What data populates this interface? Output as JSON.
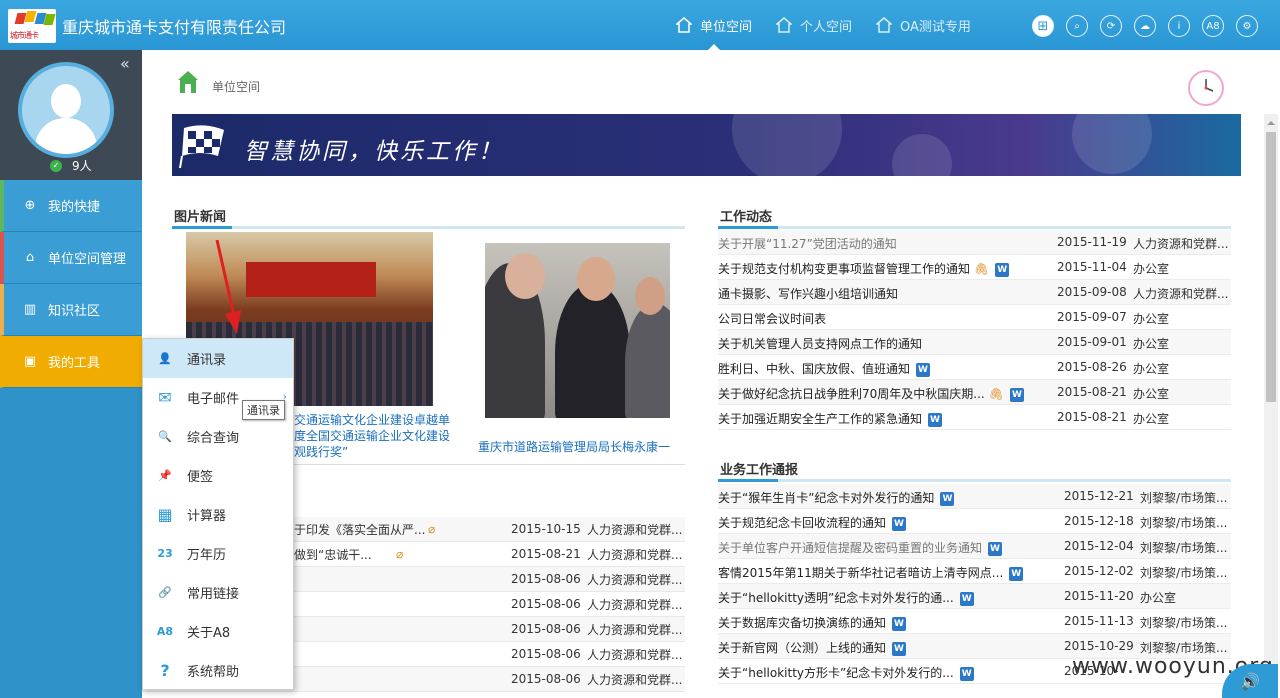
{
  "header": {
    "company": "重庆城市通卡支付有限责任公司",
    "logo_text": "城市通卡",
    "nav": [
      {
        "label": "单位空间",
        "icon": "building-icon",
        "active": true
      },
      {
        "label": "个人空间",
        "icon": "home-icon",
        "active": false
      },
      {
        "label": "OA测试专用",
        "icon": "group-icon",
        "active": false
      }
    ],
    "tools": [
      {
        "name": "grid-icon",
        "glyph": "⊞"
      },
      {
        "name": "search-icon",
        "glyph": "⌕"
      },
      {
        "name": "refresh-icon",
        "glyph": "⟳"
      },
      {
        "name": "cloud-icon",
        "glyph": "☁"
      },
      {
        "name": "info-icon",
        "glyph": "i"
      },
      {
        "name": "a8-icon",
        "glyph": "A8"
      },
      {
        "name": "settings-icon",
        "glyph": "⚙"
      }
    ]
  },
  "sidebar": {
    "collapse": "«",
    "online_count": "9人",
    "items": [
      {
        "label": "我的快捷",
        "icon": "plus-circle-icon",
        "glyph": "⊕",
        "border": "#5cb85c"
      },
      {
        "label": "单位空间管理",
        "icon": "building-icon",
        "glyph": "⌂",
        "border": "#d9534f"
      },
      {
        "label": "知识社区",
        "icon": "book-icon",
        "glyph": "▥",
        "border": "#f0ad4e"
      },
      {
        "label": "我的工具",
        "icon": "toolbox-icon",
        "glyph": "▣",
        "border": "#f0ac00"
      }
    ]
  },
  "tools_menu": {
    "items": [
      {
        "label": "通讯录",
        "icon": "contacts-icon",
        "glyph": "👤",
        "highlighted": true
      },
      {
        "label": "电子邮件",
        "icon": "mail-icon",
        "glyph": "✉",
        "submenu": true
      },
      {
        "label": "综合查询",
        "icon": "search-icon",
        "glyph": "🔍"
      },
      {
        "label": "便签",
        "icon": "pin-icon",
        "glyph": "📌"
      },
      {
        "label": "计算器",
        "icon": "calculator-icon",
        "glyph": "▦"
      },
      {
        "label": "万年历",
        "icon": "calendar-icon",
        "glyph": "23"
      },
      {
        "label": "常用链接",
        "icon": "link-icon",
        "glyph": "🔗"
      },
      {
        "label": "关于A8",
        "icon": "a8-icon",
        "glyph": "A8"
      },
      {
        "label": "系统帮助",
        "icon": "help-icon",
        "glyph": "?"
      }
    ],
    "tooltip": "通讯录"
  },
  "breadcrumb": {
    "label": "单位空间"
  },
  "banner": {
    "slogan": "智慧协同，快乐工作！"
  },
  "photo_news": {
    "title": "图片新闻",
    "caption1": "交通运输文化企业建设卓越单 度全国交通运输企业文化建设 观践行奖”",
    "caption2": "重庆市道路运输管理局局长梅永康一"
  },
  "left_list": [
    {
      "title": "于印发《落实全面从严...",
      "clip": true,
      "date": "2015-10-15",
      "org": "人力资源和党群..."
    },
    {
      "title": "做到“忠诚干...",
      "clip": true,
      "date": "2015-08-21",
      "org": "人力资源和党群..."
    },
    {
      "title": "",
      "date": "2015-08-06",
      "org": "人力资源和党群..."
    },
    {
      "title": "",
      "date": "2015-08-06",
      "org": "人力资源和党群..."
    },
    {
      "title": "",
      "date": "2015-08-06",
      "org": "人力资源和党群..."
    },
    {
      "title": "",
      "date": "2015-08-06",
      "org": "人力资源和党群..."
    },
    {
      "title": "",
      "date": "2015-08-06",
      "org": "人力资源和党群..."
    }
  ],
  "work_news": {
    "title": "工作动态",
    "rows": [
      {
        "title": "关于开展“11.27”党团活动的通知",
        "gray": true,
        "date": "2015-11-19",
        "org": "人力资源和党群..."
      },
      {
        "title": "关于规范支付机构变更事项监督管理工作的通知",
        "clip": true,
        "word": true,
        "date": "2015-11-04",
        "org": "办公室"
      },
      {
        "title": "通卡摄影、写作兴趣小组培训通知",
        "date": "2015-09-08",
        "org": "人力资源和党群..."
      },
      {
        "title": "公司日常会议时间表",
        "date": "2015-09-07",
        "org": "办公室"
      },
      {
        "title": "关于机关管理人员支持网点工作的通知",
        "date": "2015-09-01",
        "org": "办公室"
      },
      {
        "title": "胜利日、中秋、国庆放假、值班通知",
        "word": true,
        "date": "2015-08-26",
        "org": "办公室"
      },
      {
        "title": "关于做好纪念抗日战争胜利70周年及中秋国庆期...",
        "clip": true,
        "word": true,
        "date": "2015-08-21",
        "org": "办公室"
      },
      {
        "title": "关于加强近期安全生产工作的紧急通知",
        "word": true,
        "date": "2015-08-21",
        "org": "办公室"
      }
    ]
  },
  "business_news": {
    "title": "业务工作通报",
    "rows": [
      {
        "title": "关于“猴年生肖卡”纪念卡对外发行的通知",
        "word": true,
        "date": "2015-12-21",
        "org": "刘黎黎/市场策..."
      },
      {
        "title": "关于规范纪念卡回收流程的通知",
        "word": true,
        "date": "2015-12-18",
        "org": "刘黎黎/市场策..."
      },
      {
        "title": "关于单位客户开通短信提醒及密码重置的业务通知",
        "gray": true,
        "word": true,
        "date": "2015-12-04",
        "org": "刘黎黎/市场策..."
      },
      {
        "title": "客情2015年第11期关于新华社记者暗访上清寺网点...",
        "word": true,
        "date": "2015-12-02",
        "org": "刘黎黎/市场策..."
      },
      {
        "title": "关于“hellokitty透明”纪念卡对外发行的通...",
        "word": true,
        "date": "2015-11-20",
        "org": "办公室"
      },
      {
        "title": "关于数据库灾备切换演练的通知",
        "word": true,
        "date": "2015-11-13",
        "org": "刘黎黎/市场策..."
      },
      {
        "title": "关于新官网（公测）上线的通知",
        "word": true,
        "date": "2015-10-29",
        "org": "刘黎黎/市场策..."
      },
      {
        "title": "关于“hellokitty方形卡”纪念卡对外发行的...",
        "word": true,
        "date": "2015-10-",
        "org": ""
      }
    ]
  },
  "watermark": "www.wooyun.org",
  "colors": {
    "topbar": "#2e9bd7",
    "sidebar": "#3a9dd4",
    "accent_orange": "#f0ac00",
    "link": "#1a6fbf"
  }
}
